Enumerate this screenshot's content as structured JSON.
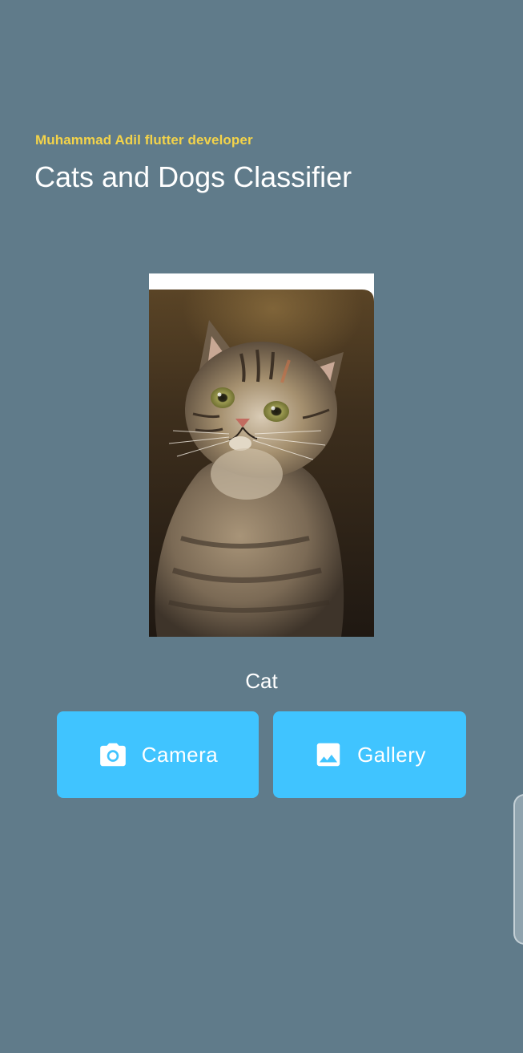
{
  "header": {
    "developer_label": "Muhammad Adil flutter developer",
    "title": "Cats and Dogs Classifier"
  },
  "preview": {
    "image_subject": "tabby cat looking up"
  },
  "result": {
    "label": "Cat"
  },
  "actions": {
    "camera": {
      "label": "Camera",
      "icon": "camera-icon"
    },
    "gallery": {
      "label": "Gallery",
      "icon": "image-icon"
    }
  },
  "colors": {
    "background": "#607b8a",
    "accent_yellow": "#f3d34a",
    "button_blue": "#40c4ff",
    "text_white": "#ffffff"
  }
}
